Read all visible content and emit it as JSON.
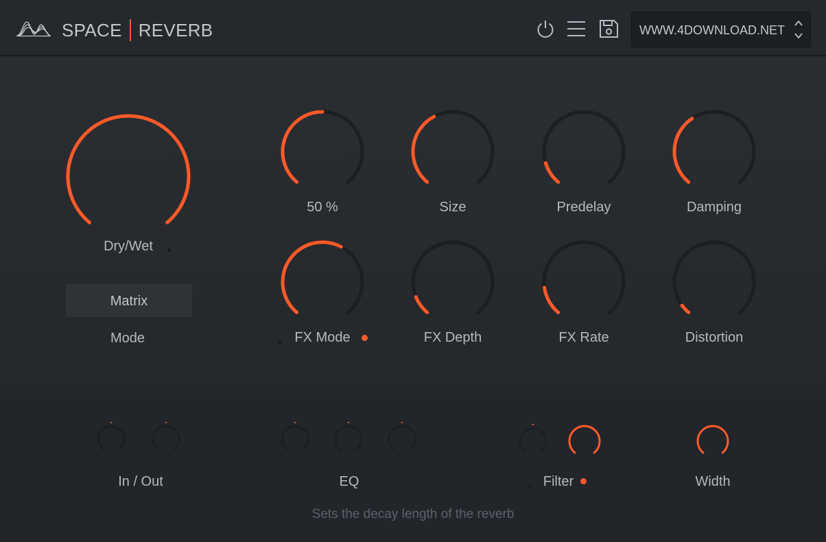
{
  "colors": {
    "accent": "#ff5a29",
    "track": "#1c1e21",
    "background": "#25282c"
  },
  "header": {
    "title_left": "SPACE",
    "title_right": "REVERB",
    "preset_name": "WWW.4DOWNLOAD.NET",
    "icons": [
      "waveform-logo-icon",
      "power-icon",
      "menu-icon",
      "save-icon",
      "preset-arrows-icon"
    ]
  },
  "main": {
    "dry_wet": {
      "label": "Dry/Wet",
      "value": 1.0
    },
    "mode": {
      "label": "Mode",
      "value": "Matrix"
    },
    "knobs": [
      {
        "label": "50 %",
        "value": 0.5
      },
      {
        "label": "Size",
        "value": 0.4
      },
      {
        "label": "Predelay",
        "value": 0.12
      },
      {
        "label": "Damping",
        "value": 0.38
      },
      {
        "label": "FX Mode",
        "value": 0.6,
        "active": true
      },
      {
        "label": "FX Depth",
        "value": 0.1
      },
      {
        "label": "FX Rate",
        "value": 0.15
      },
      {
        "label": "Distortion",
        "value": 0.05
      }
    ]
  },
  "bottom": {
    "sections": [
      {
        "label": "In / Out",
        "active": false
      },
      {
        "label": "EQ",
        "active": false
      },
      {
        "label": "Filter",
        "active": true
      },
      {
        "label": "Width",
        "active": false
      }
    ],
    "hint": "Sets the decay length of the reverb"
  }
}
